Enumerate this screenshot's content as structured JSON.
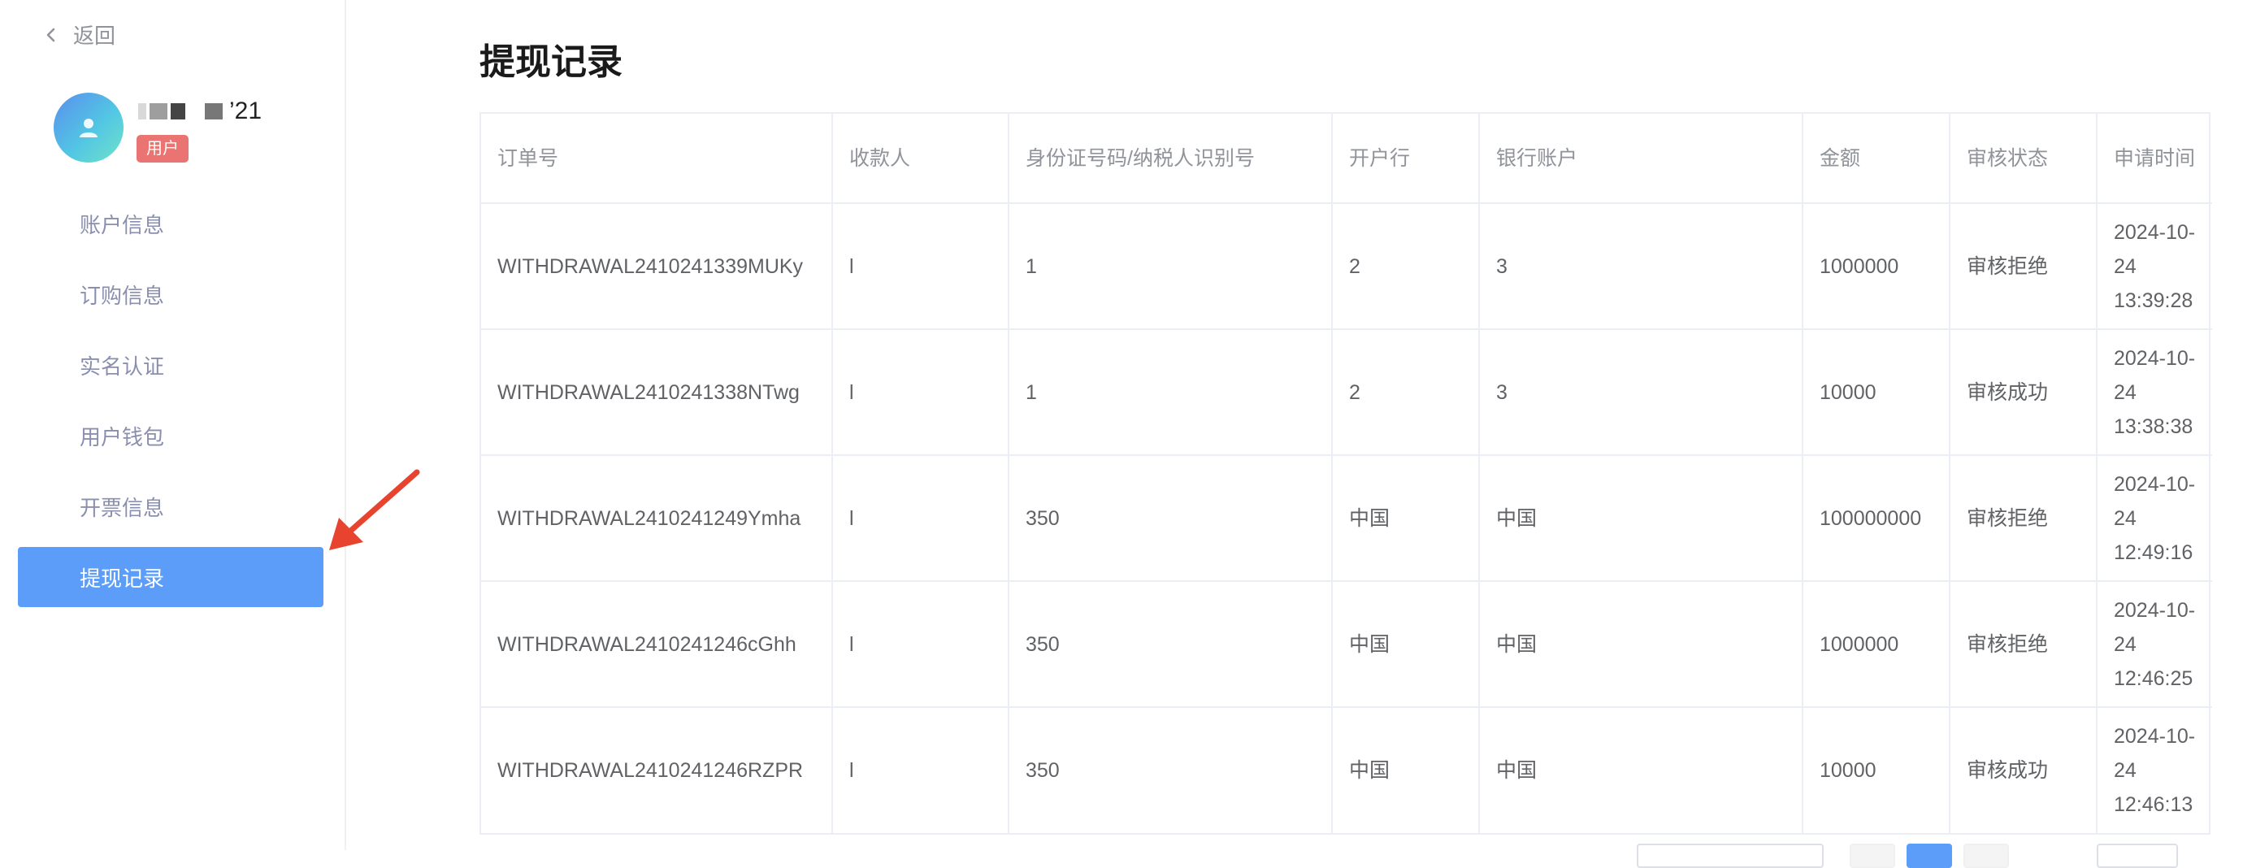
{
  "sidebar": {
    "back_label": "返回",
    "user": {
      "name_suffix": "’21",
      "role": "用户"
    },
    "items": [
      {
        "label": "账户信息",
        "active": false
      },
      {
        "label": "订购信息",
        "active": false
      },
      {
        "label": "实名认证",
        "active": false
      },
      {
        "label": "用户钱包",
        "active": false
      },
      {
        "label": "开票信息",
        "active": false
      },
      {
        "label": "提现记录",
        "active": true
      }
    ]
  },
  "main": {
    "title": "提现记录",
    "table": {
      "headers": [
        "订单号",
        "收款人",
        "身份证号码/纳税人识别号",
        "开户行",
        "银行账户",
        "金额",
        "审核状态",
        "申请时间"
      ],
      "rows": [
        [
          "WITHDRAWAL2410241339MUKy",
          "l",
          "1",
          "2",
          "3",
          "1000000",
          "审核拒绝",
          "2024-10-24 13:39:28"
        ],
        [
          "WITHDRAWAL2410241338NTwg",
          "l",
          "1",
          "2",
          "3",
          "10000",
          "审核成功",
          "2024-10-24 13:38:38"
        ],
        [
          "WITHDRAWAL2410241249Ymha",
          "l",
          "350",
          "中国",
          "中国",
          "100000000",
          "审核拒绝",
          "2024-10-24 12:49:16"
        ],
        [
          "WITHDRAWAL2410241246cGhh",
          "l",
          "350",
          "中国",
          "中国",
          "1000000",
          "审核拒绝",
          "2024-10-24 12:46:25"
        ],
        [
          "WITHDRAWAL2410241246RZPR",
          "l",
          "350",
          "中国",
          "中国",
          "10000",
          "审核成功",
          "2024-10-24 12:46:13"
        ]
      ]
    }
  },
  "colors": {
    "accent": "#5b9df9",
    "badge": "#e97471",
    "annotation_arrow": "#e8432f"
  }
}
